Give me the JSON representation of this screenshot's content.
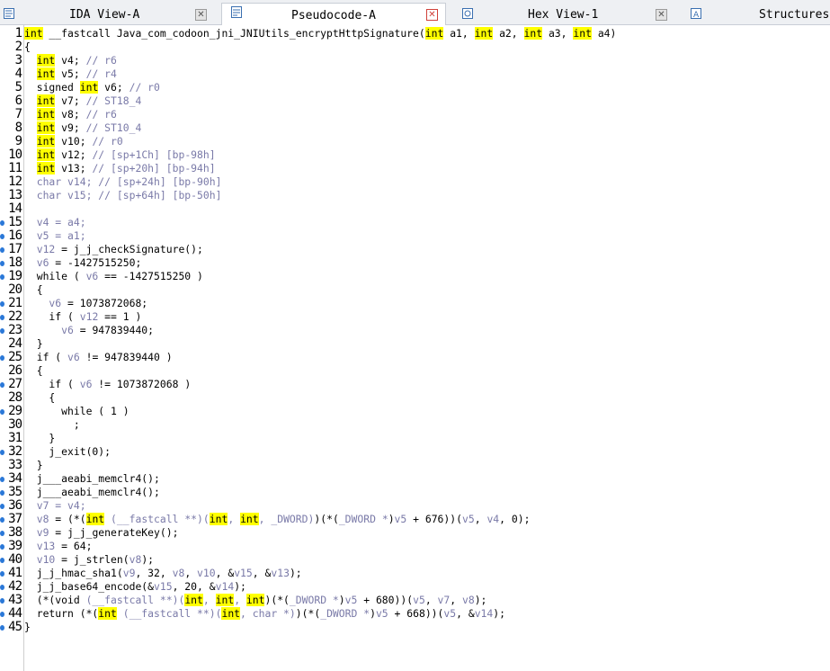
{
  "tabs": [
    {
      "label": "IDA View-A",
      "icon": "disassembly-icon",
      "close": "close-icon",
      "active": false
    },
    {
      "label": "Pseudocode-A",
      "icon": "pseudocode-icon",
      "close": "close-icon",
      "active": true
    },
    {
      "label": "Hex View-1",
      "icon": "hex-view-icon",
      "close": "close-icon",
      "active": false
    },
    {
      "label": "Structures",
      "icon": "structures-icon",
      "active": false
    }
  ],
  "colors": {
    "keyword_highlight": "#ffff00",
    "breakpoint_dot": "#2a78d8",
    "close_active": "#d0413a"
  },
  "code": [
    {
      "n": "1",
      "dot": false,
      "t": [
        [
          "kw",
          "int"
        ],
        [
          "p",
          " __fastcall Java_com_codoon_jni_JNIUtils_encryptHttpSignature("
        ],
        [
          "kw",
          "int"
        ],
        [
          "p",
          " a1, "
        ],
        [
          "kw",
          "int"
        ],
        [
          "p",
          " a2, "
        ],
        [
          "kw",
          "int"
        ],
        [
          "p",
          " a3, "
        ],
        [
          "kw",
          "int"
        ],
        [
          "p",
          " a4)"
        ]
      ]
    },
    {
      "n": "2",
      "dot": false,
      "t": [
        [
          "p",
          "{"
        ]
      ]
    },
    {
      "n": "3",
      "dot": false,
      "t": [
        [
          "p",
          "  "
        ],
        [
          "kw",
          "int"
        ],
        [
          "p",
          " v4; "
        ],
        [
          "c",
          "// r6"
        ]
      ]
    },
    {
      "n": "4",
      "dot": false,
      "t": [
        [
          "p",
          "  "
        ],
        [
          "kw",
          "int"
        ],
        [
          "p",
          " v5; "
        ],
        [
          "c",
          "// r4"
        ]
      ]
    },
    {
      "n": "5",
      "dot": false,
      "t": [
        [
          "p",
          "  signed "
        ],
        [
          "kw",
          "int"
        ],
        [
          "p",
          " v6; "
        ],
        [
          "c",
          "// r0"
        ]
      ]
    },
    {
      "n": "6",
      "dot": false,
      "t": [
        [
          "p",
          "  "
        ],
        [
          "kw",
          "int"
        ],
        [
          "p",
          " v7; "
        ],
        [
          "c",
          "// ST18_4"
        ]
      ]
    },
    {
      "n": "7",
      "dot": false,
      "t": [
        [
          "p",
          "  "
        ],
        [
          "kw",
          "int"
        ],
        [
          "p",
          " v8; "
        ],
        [
          "c",
          "// r6"
        ]
      ]
    },
    {
      "n": "8",
      "dot": false,
      "t": [
        [
          "p",
          "  "
        ],
        [
          "kw",
          "int"
        ],
        [
          "p",
          " v9; "
        ],
        [
          "c",
          "// ST10_4"
        ]
      ]
    },
    {
      "n": "9",
      "dot": false,
      "t": [
        [
          "p",
          "  "
        ],
        [
          "kw",
          "int"
        ],
        [
          "p",
          " v10; "
        ],
        [
          "c",
          "// r0"
        ]
      ]
    },
    {
      "n": "10",
      "dot": false,
      "t": [
        [
          "p",
          "  "
        ],
        [
          "kw",
          "int"
        ],
        [
          "p",
          " v12; "
        ],
        [
          "c",
          "// [sp+1Ch] [bp-98h]"
        ]
      ]
    },
    {
      "n": "11",
      "dot": false,
      "t": [
        [
          "p",
          "  "
        ],
        [
          "kw",
          "int"
        ],
        [
          "p",
          " v13; "
        ],
        [
          "c",
          "// [sp+20h] [bp-94h]"
        ]
      ]
    },
    {
      "n": "12",
      "dot": false,
      "t": [
        [
          "v",
          "  char v14; // [sp+24h] [bp-90h]"
        ]
      ]
    },
    {
      "n": "13",
      "dot": false,
      "t": [
        [
          "v",
          "  char v15; // [sp+64h] [bp-50h]"
        ]
      ]
    },
    {
      "n": "14",
      "dot": false,
      "t": [
        [
          "p",
          ""
        ]
      ]
    },
    {
      "n": "15",
      "dot": true,
      "t": [
        [
          "v",
          "  v4 = a4;"
        ]
      ]
    },
    {
      "n": "16",
      "dot": true,
      "t": [
        [
          "v",
          "  v5 = a1;"
        ]
      ]
    },
    {
      "n": "17",
      "dot": true,
      "t": [
        [
          "v",
          "  v12"
        ],
        [
          "p",
          " = j_j_checkSignature();"
        ]
      ]
    },
    {
      "n": "18",
      "dot": true,
      "t": [
        [
          "v",
          "  v6"
        ],
        [
          "p",
          " = -1427515250;"
        ]
      ]
    },
    {
      "n": "19",
      "dot": true,
      "t": [
        [
          "p",
          "  while ( "
        ],
        [
          "v",
          "v6"
        ],
        [
          "p",
          " == -1427515250 )"
        ]
      ]
    },
    {
      "n": "20",
      "dot": false,
      "t": [
        [
          "p",
          "  {"
        ]
      ]
    },
    {
      "n": "21",
      "dot": true,
      "t": [
        [
          "v",
          "    v6"
        ],
        [
          "p",
          " = 1073872068;"
        ]
      ]
    },
    {
      "n": "22",
      "dot": true,
      "t": [
        [
          "p",
          "    if ( "
        ],
        [
          "v",
          "v12"
        ],
        [
          "p",
          " == 1 )"
        ]
      ]
    },
    {
      "n": "23",
      "dot": true,
      "t": [
        [
          "v",
          "      v6"
        ],
        [
          "p",
          " = 947839440;"
        ]
      ]
    },
    {
      "n": "24",
      "dot": false,
      "t": [
        [
          "p",
          "  }"
        ]
      ]
    },
    {
      "n": "25",
      "dot": true,
      "t": [
        [
          "p",
          "  if ( "
        ],
        [
          "v",
          "v6"
        ],
        [
          "p",
          " != 947839440 )"
        ]
      ]
    },
    {
      "n": "26",
      "dot": false,
      "t": [
        [
          "p",
          "  {"
        ]
      ]
    },
    {
      "n": "27",
      "dot": true,
      "t": [
        [
          "p",
          "    if ( "
        ],
        [
          "v",
          "v6"
        ],
        [
          "p",
          " != 1073872068 )"
        ]
      ]
    },
    {
      "n": "28",
      "dot": false,
      "t": [
        [
          "p",
          "    {"
        ]
      ]
    },
    {
      "n": "29",
      "dot": true,
      "t": [
        [
          "p",
          "      while ( 1 )"
        ]
      ]
    },
    {
      "n": "30",
      "dot": false,
      "t": [
        [
          "p",
          "        ;"
        ]
      ]
    },
    {
      "n": "31",
      "dot": false,
      "t": [
        [
          "p",
          "    }"
        ]
      ]
    },
    {
      "n": "32",
      "dot": true,
      "t": [
        [
          "p",
          "    j_exit(0);"
        ]
      ]
    },
    {
      "n": "33",
      "dot": false,
      "t": [
        [
          "p",
          "  }"
        ]
      ]
    },
    {
      "n": "34",
      "dot": true,
      "t": [
        [
          "p",
          "  j___aeabi_memclr4();"
        ]
      ]
    },
    {
      "n": "35",
      "dot": true,
      "t": [
        [
          "p",
          "  j___aeabi_memclr4();"
        ]
      ]
    },
    {
      "n": "36",
      "dot": true,
      "t": [
        [
          "v",
          "  v7 = v4;"
        ]
      ]
    },
    {
      "n": "37",
      "dot": true,
      "t": [
        [
          "v",
          "  v8"
        ],
        [
          "p",
          " = (*("
        ],
        [
          "kw",
          "int"
        ],
        [
          "v",
          " (__fastcall **)("
        ],
        [
          "kw",
          "int"
        ],
        [
          "v",
          ", "
        ],
        [
          "kw",
          "int"
        ],
        [
          "v",
          ", _DWORD)"
        ],
        [
          "p",
          ")(*("
        ],
        [
          "v",
          "_DWORD *"
        ],
        [
          "p",
          ")"
        ],
        [
          "v",
          "v5"
        ],
        [
          "p",
          " + 676))("
        ],
        [
          "v",
          "v5"
        ],
        [
          "p",
          ", "
        ],
        [
          "v",
          "v4"
        ],
        [
          "p",
          ", 0);"
        ]
      ]
    },
    {
      "n": "38",
      "dot": true,
      "t": [
        [
          "v",
          "  v9"
        ],
        [
          "p",
          " = j_j_generateKey();"
        ]
      ]
    },
    {
      "n": "39",
      "dot": true,
      "t": [
        [
          "v",
          "  v13"
        ],
        [
          "p",
          " = 64;"
        ]
      ]
    },
    {
      "n": "40",
      "dot": true,
      "t": [
        [
          "v",
          "  v10"
        ],
        [
          "p",
          " = j_strlen("
        ],
        [
          "v",
          "v8"
        ],
        [
          "p",
          ");"
        ]
      ]
    },
    {
      "n": "41",
      "dot": true,
      "t": [
        [
          "p",
          "  j_j_hmac_sha1("
        ],
        [
          "v",
          "v9"
        ],
        [
          "p",
          ", 32, "
        ],
        [
          "v",
          "v8"
        ],
        [
          "p",
          ", "
        ],
        [
          "v",
          "v10"
        ],
        [
          "p",
          ", &"
        ],
        [
          "v",
          "v15"
        ],
        [
          "p",
          ", &"
        ],
        [
          "v",
          "v13"
        ],
        [
          "p",
          ");"
        ]
      ]
    },
    {
      "n": "42",
      "dot": true,
      "t": [
        [
          "p",
          "  j_j_base64_encode(&"
        ],
        [
          "v",
          "v15"
        ],
        [
          "p",
          ", 20, &"
        ],
        [
          "v",
          "v14"
        ],
        [
          "p",
          ");"
        ]
      ]
    },
    {
      "n": "43",
      "dot": true,
      "t": [
        [
          "p",
          "  (*(void "
        ],
        [
          "v",
          "(__fastcall **)("
        ],
        [
          "kw",
          "int"
        ],
        [
          "v",
          ", "
        ],
        [
          "kw",
          "int"
        ],
        [
          "v",
          ", "
        ],
        [
          "kw",
          "int"
        ],
        [
          "p",
          ")(*("
        ],
        [
          "v",
          "_DWORD *"
        ],
        [
          "p",
          ")"
        ],
        [
          "v",
          "v5"
        ],
        [
          "p",
          " + 680))("
        ],
        [
          "v",
          "v5"
        ],
        [
          "p",
          ", "
        ],
        [
          "v",
          "v7"
        ],
        [
          "p",
          ", "
        ],
        [
          "v",
          "v8"
        ],
        [
          "p",
          ");"
        ]
      ]
    },
    {
      "n": "44",
      "dot": true,
      "t": [
        [
          "p",
          "  return (*("
        ],
        [
          "kw",
          "int"
        ],
        [
          "v",
          " (__fastcall **)("
        ],
        [
          "kw",
          "int"
        ],
        [
          "v",
          ", char *)"
        ],
        [
          "p",
          ")(*("
        ],
        [
          "v",
          "_DWORD *"
        ],
        [
          "p",
          ")"
        ],
        [
          "v",
          "v5"
        ],
        [
          "p",
          " + 668))("
        ],
        [
          "v",
          "v5"
        ],
        [
          "p",
          ", &"
        ],
        [
          "v",
          "v14"
        ],
        [
          "p",
          ");"
        ]
      ]
    },
    {
      "n": "45",
      "dot": true,
      "t": [
        [
          "p",
          "}"
        ]
      ]
    }
  ]
}
